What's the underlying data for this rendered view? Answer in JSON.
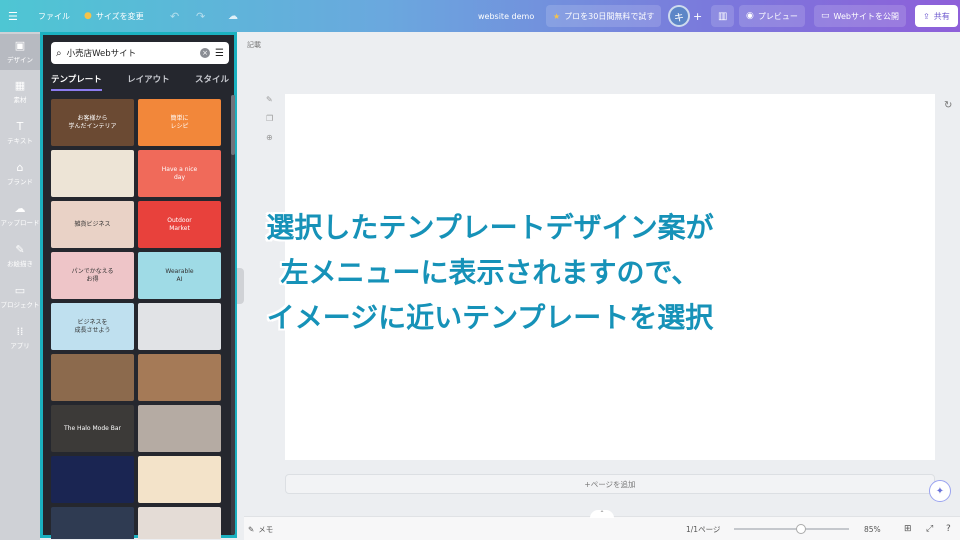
{
  "topbar": {
    "menu_icon": "menu-icon",
    "file_label": "ファイル",
    "resize_label": "サイズを変更",
    "title": "website demo",
    "pro_label": "プロを30日間無料で試す",
    "avatar_initial": "キ",
    "preview_label": "プレビュー",
    "publish_label": "Webサイトを公開",
    "share_label": "共有"
  },
  "rail": {
    "items": [
      {
        "label": "デザイン",
        "icon": "▣"
      },
      {
        "label": "素材",
        "icon": "▦"
      },
      {
        "label": "テキスト",
        "icon": "T"
      },
      {
        "label": "ブランド",
        "icon": "⌂"
      },
      {
        "label": "アップロード",
        "icon": "☁"
      },
      {
        "label": "お絵描き",
        "icon": "✎"
      },
      {
        "label": "プロジェクト",
        "icon": "▭"
      },
      {
        "label": "アプリ",
        "icon": "⁞⁞"
      }
    ]
  },
  "panel": {
    "search_value": "小売店Webサイト",
    "tabs": [
      "テンプレート",
      "レイアウト",
      "スタイル"
    ],
    "thumbs": [
      {
        "text": "お客様から\n学んだインテリア",
        "bg": "#6b4a33"
      },
      {
        "text": "簡単に\nレシピ",
        "bg": "#f2873a"
      },
      {
        "text": "",
        "bg": "#ede4d6"
      },
      {
        "text": "Have a nice\nday",
        "bg": "#f06a5a"
      },
      {
        "text": "雑貨ビジネス",
        "bg": "#e9d2c6"
      },
      {
        "text": "Outdoor\nMarket",
        "bg": "#e8413c"
      },
      {
        "text": "パンでかなえる\nお得",
        "bg": "#eec5c8"
      },
      {
        "text": "Wearable\nAI",
        "bg": "#9fdbe6"
      },
      {
        "text": "ビジネスを\n成長させよう",
        "bg": "#bfe0ef"
      },
      {
        "text": "",
        "bg": "#e1e3e6"
      },
      {
        "text": "",
        "bg": "#8c6a4d"
      },
      {
        "text": "",
        "bg": "#a57a57"
      },
      {
        "text": "The Halo Mode Bar",
        "bg": "#3c3a38"
      },
      {
        "text": "",
        "bg": "#b5aba3"
      },
      {
        "text": "",
        "bg": "#1a2552"
      },
      {
        "text": "",
        "bg": "#f3e3c9"
      },
      {
        "text": "",
        "bg": "#2f3b52"
      },
      {
        "text": "",
        "bg": "#e4dcd6"
      }
    ]
  },
  "canvas": {
    "memo_top": "記載",
    "add_page_label": "+ページを追加"
  },
  "bottombar": {
    "memo_label": "メモ",
    "page_count": "1/1ページ",
    "zoom": "85%"
  },
  "caption": {
    "line1": "選択したテンプレートデザイン案が",
    "line2": "左メニューに表示されますので、",
    "line3": "イメージに近いテンプレートを選択"
  }
}
